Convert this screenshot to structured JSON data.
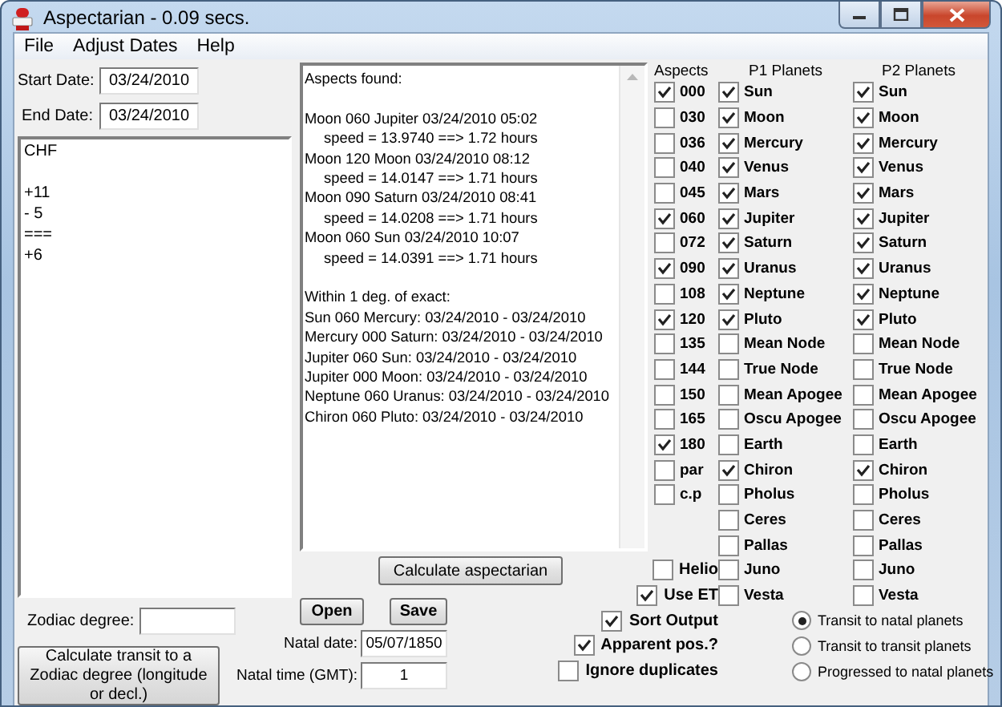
{
  "window": {
    "title": "Aspectarian - 0.09 secs."
  },
  "menu": [
    "File",
    "Adjust Dates",
    "Help"
  ],
  "start_date": {
    "label": "Start Date:",
    "value": "03/24/2010"
  },
  "end_date": {
    "label": "End Date:",
    "value": "03/24/2010"
  },
  "notes": {
    "value": "CHF\n\n+11\n- 5\n===\n+6"
  },
  "zodiac_degree": {
    "label": "Zodiac degree:"
  },
  "zodiac_button": "Calculate transit to a Zodiac degree (longitude or decl.)",
  "output": {
    "heading": "Aspects found:",
    "entries": [
      {
        "line": "Moon 060 Jupiter 03/24/2010 05:02",
        "speed": "speed = 13.9740 ==> 1.72 hours"
      },
      {
        "line": "Moon 120 Moon 03/24/2010 08:12",
        "speed": "speed = 14.0147 ==> 1.71 hours"
      },
      {
        "line": "Moon 090 Saturn 03/24/2010 08:41",
        "speed": "speed = 14.0208 ==> 1.71 hours"
      },
      {
        "line": "Moon 060 Sun 03/24/2010 10:07",
        "speed": "speed = 14.0391 ==> 1.71 hours"
      }
    ],
    "exact_heading": "Within 1 deg. of exact:",
    "exact": [
      "Sun 060 Mercury: 03/24/2010 - 03/24/2010",
      "Mercury 000 Saturn: 03/24/2010 - 03/24/2010",
      "Jupiter 060 Sun: 03/24/2010 - 03/24/2010",
      "Jupiter 000 Moon: 03/24/2010 - 03/24/2010",
      "Neptune 060 Uranus: 03/24/2010 - 03/24/2010",
      "Chiron 060 Pluto: 03/24/2010 - 03/24/2010"
    ]
  },
  "calculate_button": "Calculate aspectarian",
  "open_button": "Open",
  "save_button": "Save",
  "natal_date": {
    "label": "Natal date:",
    "value": "05/07/1850"
  },
  "natal_time": {
    "label": "Natal time (GMT):",
    "value": "1"
  },
  "aspects": {
    "heading": "Aspects",
    "items": [
      {
        "label": "000",
        "checked": true
      },
      {
        "label": "030",
        "checked": false
      },
      {
        "label": "036",
        "checked": false
      },
      {
        "label": "040",
        "checked": false
      },
      {
        "label": "045",
        "checked": false
      },
      {
        "label": "060",
        "checked": true
      },
      {
        "label": "072",
        "checked": false
      },
      {
        "label": "090",
        "checked": true
      },
      {
        "label": "108",
        "checked": false
      },
      {
        "label": "120",
        "checked": true
      },
      {
        "label": "135",
        "checked": false
      },
      {
        "label": "144",
        "checked": false
      },
      {
        "label": "150",
        "checked": false
      },
      {
        "label": "165",
        "checked": false
      },
      {
        "label": "180",
        "checked": true
      },
      {
        "label": "par",
        "checked": false
      },
      {
        "label": "c.p",
        "checked": false
      }
    ]
  },
  "p1_planets": {
    "heading": "P1 Planets",
    "items": [
      {
        "label": "Sun",
        "checked": true
      },
      {
        "label": "Moon",
        "checked": true
      },
      {
        "label": "Mercury",
        "checked": true
      },
      {
        "label": "Venus",
        "checked": true
      },
      {
        "label": "Mars",
        "checked": true
      },
      {
        "label": "Jupiter",
        "checked": true
      },
      {
        "label": "Saturn",
        "checked": true
      },
      {
        "label": "Uranus",
        "checked": true
      },
      {
        "label": "Neptune",
        "checked": true
      },
      {
        "label": "Pluto",
        "checked": true
      },
      {
        "label": "Mean Node",
        "checked": false
      },
      {
        "label": "True Node",
        "checked": false
      },
      {
        "label": "Mean Apogee",
        "checked": false
      },
      {
        "label": "Oscu Apogee",
        "checked": false
      },
      {
        "label": "Earth",
        "checked": false
      },
      {
        "label": "Chiron",
        "checked": true
      },
      {
        "label": "Pholus",
        "checked": false
      },
      {
        "label": "Ceres",
        "checked": false
      },
      {
        "label": "Pallas",
        "checked": false
      },
      {
        "label": "Juno",
        "checked": false
      },
      {
        "label": "Vesta",
        "checked": false
      }
    ]
  },
  "p2_planets": {
    "heading": "P2 Planets",
    "items": [
      {
        "label": "Sun",
        "checked": true
      },
      {
        "label": "Moon",
        "checked": true
      },
      {
        "label": "Mercury",
        "checked": true
      },
      {
        "label": "Venus",
        "checked": true
      },
      {
        "label": "Mars",
        "checked": true
      },
      {
        "label": "Jupiter",
        "checked": true
      },
      {
        "label": "Saturn",
        "checked": true
      },
      {
        "label": "Uranus",
        "checked": true
      },
      {
        "label": "Neptune",
        "checked": true
      },
      {
        "label": "Pluto",
        "checked": true
      },
      {
        "label": "Mean Node",
        "checked": false
      },
      {
        "label": "True Node",
        "checked": false
      },
      {
        "label": "Mean Apogee",
        "checked": false
      },
      {
        "label": "Oscu Apogee",
        "checked": false
      },
      {
        "label": "Earth",
        "checked": false
      },
      {
        "label": "Chiron",
        "checked": true
      },
      {
        "label": "Pholus",
        "checked": false
      },
      {
        "label": "Ceres",
        "checked": false
      },
      {
        "label": "Pallas",
        "checked": false
      },
      {
        "label": "Juno",
        "checked": false
      },
      {
        "label": "Vesta",
        "checked": false
      }
    ]
  },
  "options": [
    {
      "label": "Helio",
      "checked": false
    },
    {
      "label": "Use ET",
      "checked": true
    },
    {
      "label": "Sort Output",
      "checked": true
    },
    {
      "label": "Apparent pos.?",
      "checked": true
    },
    {
      "label": "Ignore duplicates",
      "checked": false
    }
  ],
  "modes": [
    {
      "label": "Transit to natal planets",
      "selected": true
    },
    {
      "label": "Transit to transit planets",
      "selected": false
    },
    {
      "label": "Progressed to natal planets",
      "selected": false
    }
  ]
}
